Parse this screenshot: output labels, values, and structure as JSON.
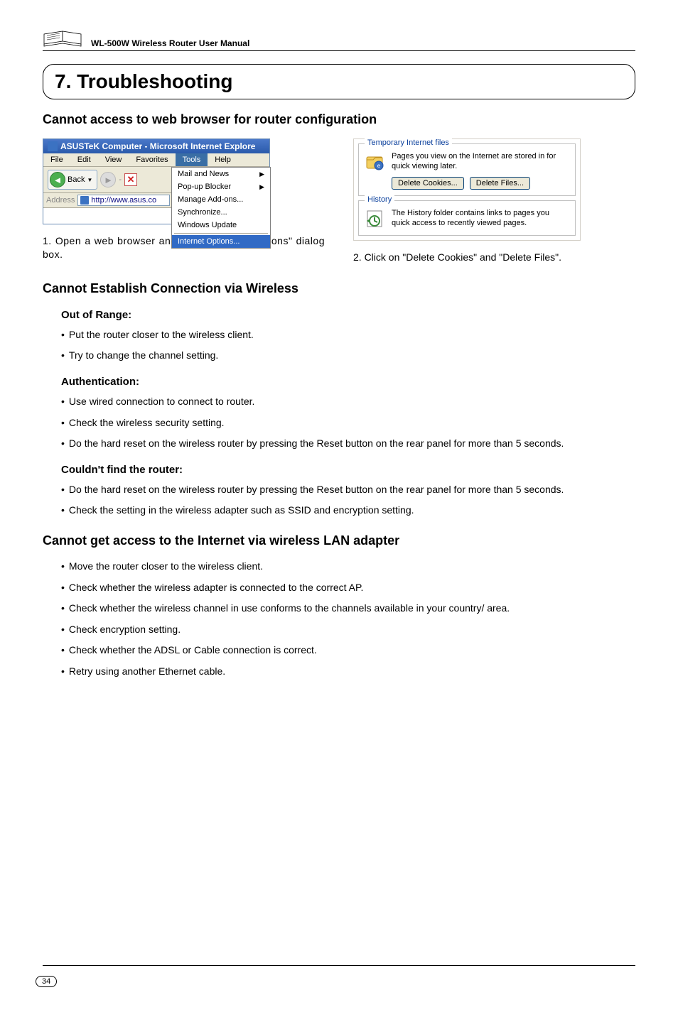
{
  "header": {
    "manual_title": "WL-500W Wireless Router User Manual"
  },
  "chapter": {
    "title": "7. Troubleshooting"
  },
  "section1": {
    "title": "Cannot access to web browser for router configuration",
    "ie": {
      "window_title": "ASUSTeK Computer - Microsoft Internet Explore",
      "menus": [
        "File",
        "Edit",
        "View",
        "Favorites",
        "Tools",
        "Help"
      ],
      "back_label": "Back",
      "address_label": "Address",
      "address_value": "http://www.asus.co",
      "dropdown": [
        "Mail and News",
        "Pop-up Blocker",
        "Manage Add-ons...",
        "Synchronize...",
        "Windows Update",
        "Internet Options..."
      ]
    },
    "opts": {
      "temp_title": "Temporary Internet files",
      "temp_text": "Pages you view on the Internet are stored in for quick viewing later.",
      "delete_cookies": "Delete Cookies...",
      "delete_files": "Delete Files...",
      "history_title": "History",
      "history_text": "The History folder contains links to pages you quick access to recently viewed pages."
    },
    "caption1": "1. Open a web browser and open \"Internet Options\" dialog box.",
    "caption2": "2. Click on \"Delete Cookies\" and \"Delete Files\"."
  },
  "section2": {
    "title": "Cannot Establish Connection via Wireless",
    "sub1": "Out of Range:",
    "sub1_items": [
      "Put the router closer to the wireless client.",
      "Try to change the channel setting."
    ],
    "sub2": "Authentication:",
    "sub2_items": [
      "Use wired connection to connect to router.",
      "Check the wireless security setting.",
      "Do the hard reset on the wireless router by pressing the Reset button on the rear panel for more than 5 seconds."
    ],
    "sub3": "Couldn't find the router:",
    "sub3_items": [
      "Do the hard reset on the wireless router by pressing the Reset button on the rear panel for more than 5 seconds.",
      "Check the setting in the wireless adapter such as SSID and encryption setting."
    ]
  },
  "section3": {
    "title": "Cannot get access to the Internet via wireless LAN adapter",
    "items": [
      "Move the router closer to the wireless client.",
      "Check whether the wireless adapter is connected to the correct AP.",
      "Check whether the wireless channel in use conforms to the channels available in your country/ area.",
      "Check encryption setting.",
      "Check whether the ADSL or Cable connection is correct.",
      "Retry using another Ethernet cable."
    ]
  },
  "page_number": "34"
}
